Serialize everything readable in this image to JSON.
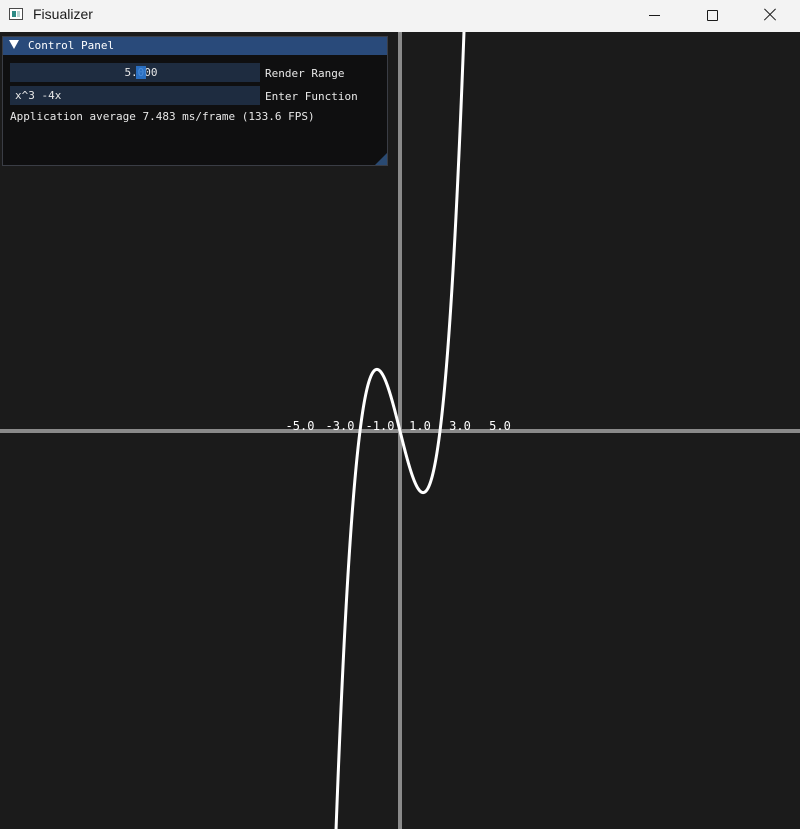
{
  "window": {
    "title": "Fisualizer",
    "icon": "app-window-icon",
    "controls": [
      "minimize-icon",
      "maximize-icon",
      "close-icon"
    ]
  },
  "control_panel": {
    "title": "Control Panel",
    "render_range": {
      "value": "5.000",
      "label": "Render Range"
    },
    "function_input": {
      "value": "x^3 -4x",
      "label": "Enter Function"
    },
    "status": "Application average 7.483 ms/frame (133.6 FPS)"
  },
  "chart_data": {
    "type": "line",
    "function": "x^3 -4x",
    "xlim": [
      -5,
      5
    ],
    "ylim": [
      -5,
      5
    ],
    "x_tick_labels": [
      "-5.0",
      "-3.0",
      "-1.0",
      "1.0",
      "3.0",
      "5.0"
    ],
    "colors": {
      "background": "#1b1b1b",
      "axis": "#8a8a8a",
      "curve": "#ffffff"
    }
  }
}
